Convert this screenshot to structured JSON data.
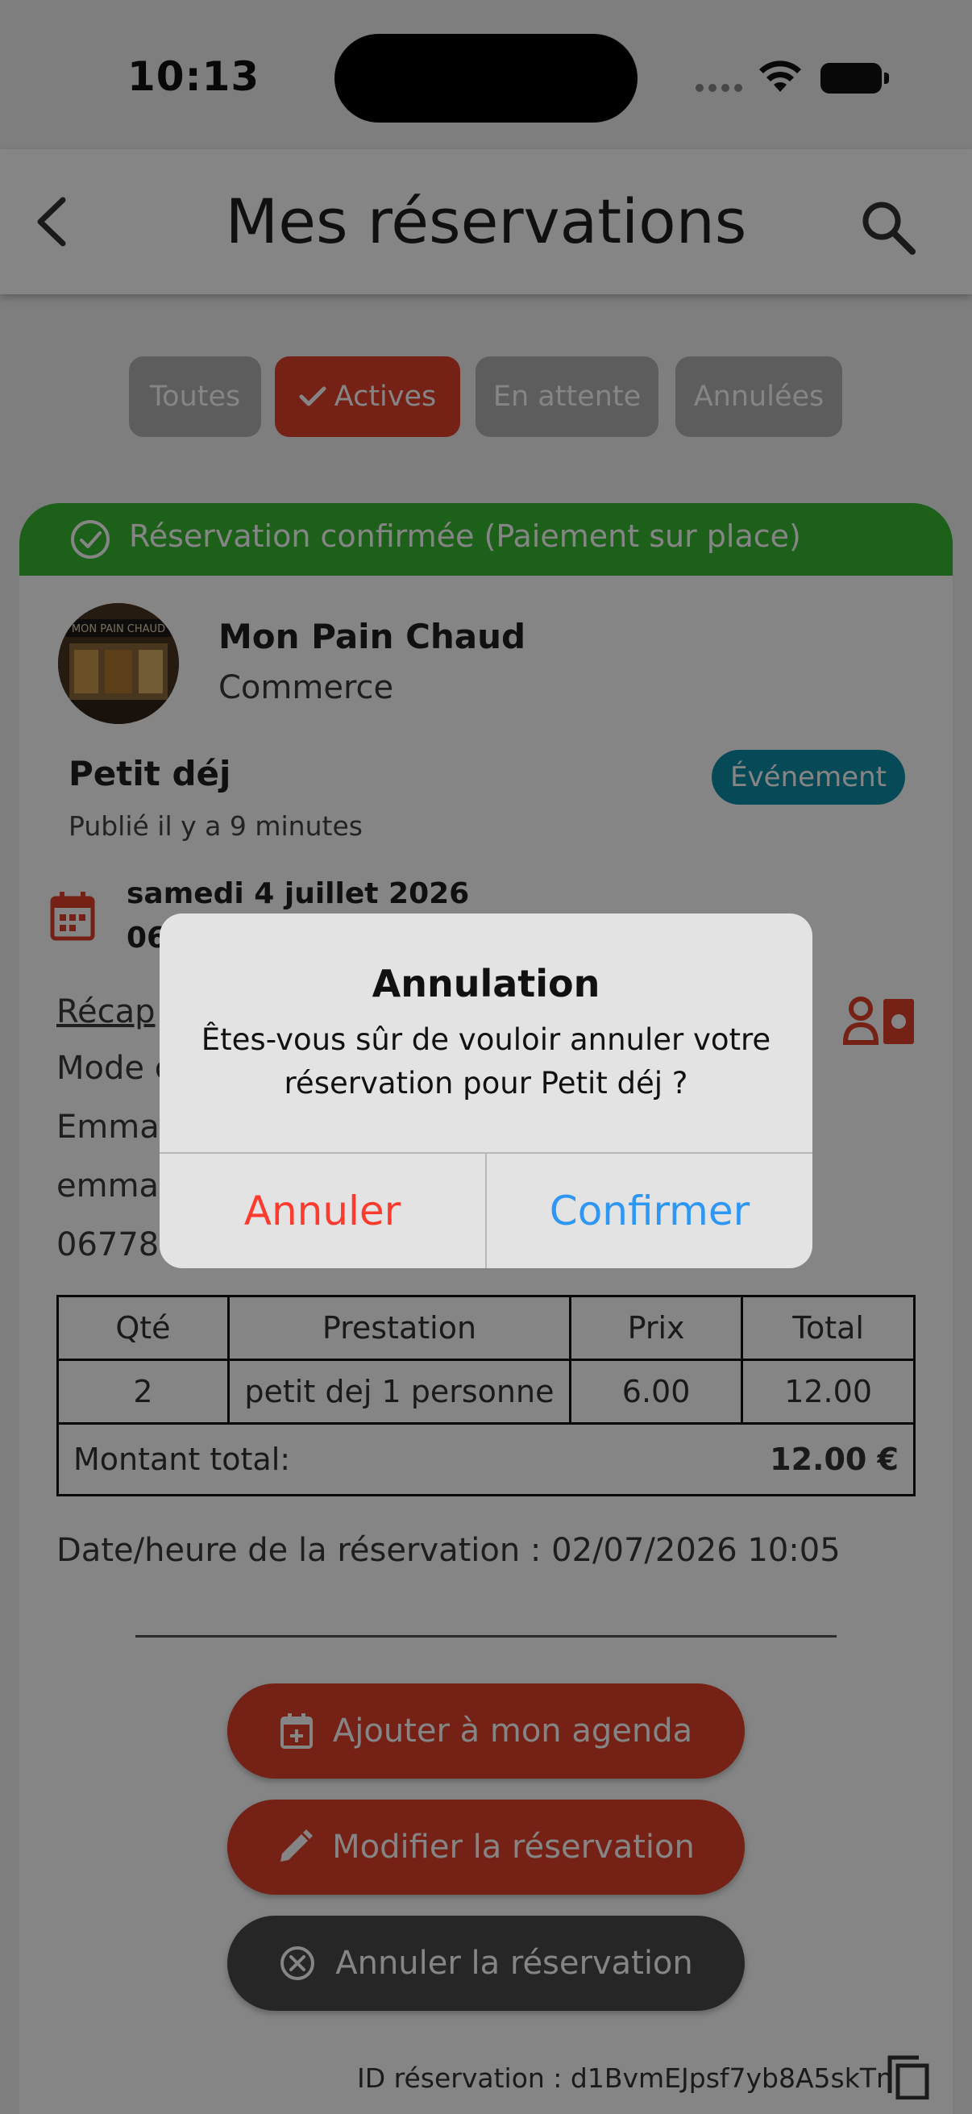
{
  "status_bar": {
    "time": "10:13"
  },
  "app_bar": {
    "title": "Mes réservations"
  },
  "filters": [
    {
      "label": "Toutes",
      "active": false
    },
    {
      "label": "Actives",
      "active": true
    },
    {
      "label": "En attente",
      "active": false
    },
    {
      "label": "Annulées",
      "active": false
    }
  ],
  "reservation": {
    "status": "Réservation confirmée (Paiement sur place)",
    "shop": {
      "name": "Mon Pain Chaud",
      "category": "Commerce",
      "sign_text": "MON PAIN CHAUD"
    },
    "offer": {
      "title": "Petit déj",
      "badge": "Événement",
      "published": "Publié il y a 9 minutes"
    },
    "date": "samedi 4 juillet 2026",
    "time_partial": "06",
    "recap": {
      "heading": "Récap",
      "lines": [
        "Mode c",
        "Emma",
        "emmar",
        "06778"
      ]
    },
    "table": {
      "headers": [
        "Qté",
        "Prestation",
        "Prix",
        "Total"
      ],
      "rows": [
        [
          "2",
          "petit dej 1 personne",
          "6.00",
          "12.00"
        ]
      ],
      "total_label": "Montant total:",
      "total_value": "12.00 €"
    },
    "booking_datetime": "Date/heure de la réservation : 02/07/2026 10:05",
    "actions": {
      "agenda": "Ajouter à mon agenda",
      "modify": "Modifier la réservation",
      "cancel": "Annuler la réservation"
    },
    "id_text": "ID réservation : d1BvmEJpsf7yb8A5skTn"
  },
  "dialog": {
    "title": "Annulation",
    "message": "Êtes-vous sûr de vouloir annuler votre réservation pour Petit déj ?",
    "cancel_label": "Annuler",
    "confirm_label": "Confirmer"
  },
  "colors": {
    "accent_red": "#e0402a",
    "status_green": "#37b830",
    "badge_teal": "#0e8fa8",
    "dialog_destructive": "#ff3b30",
    "dialog_primary": "#2e96f5"
  }
}
